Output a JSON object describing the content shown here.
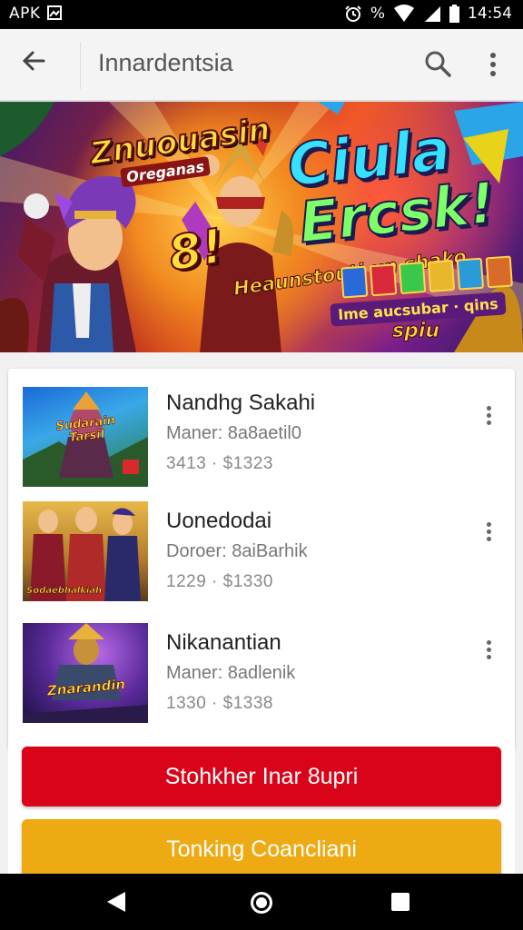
{
  "status_bar": {
    "left_text": "APK",
    "right_percent": "%",
    "time": "14:54",
    "icons": [
      "image-icon",
      "alarm-icon",
      "wifi-icon",
      "signal-icon",
      "battery-icon"
    ]
  },
  "app_bar": {
    "title": "Innardentsia",
    "icons": [
      "back-arrow-icon",
      "search-icon",
      "more-vert-icon"
    ]
  },
  "banner": {
    "logo_text": "Znuouasin",
    "logo_sub": "Oreganas",
    "title_line1": "Ciula",
    "title_line2": "Ercsk!",
    "number": "8!",
    "tag1": "Heaunstouti un shako",
    "tag2": "Ime aucsubar · qins",
    "tag3": "spiu"
  },
  "list": {
    "items": [
      {
        "name": "Nandhg Sakahi",
        "sub": "Maner: 8a8aetil0",
        "meta": "3413 · $1323",
        "thumb_caption": "Sudarain Tarsil"
      },
      {
        "name": "Uonedodai",
        "sub": "Doroer: 8aiBarhik",
        "meta": "1229 · $1330",
        "thumb_caption": "Sodaebhalkiah"
      },
      {
        "name": "Nikanantian",
        "sub": "Maner: 8adlenik",
        "meta": "1330 · $1338",
        "thumb_caption": "Znarandin"
      }
    ]
  },
  "buttons": {
    "primary": "Stohkher Inar 8upri",
    "secondary": "Tonking Coancliani"
  },
  "colors": {
    "primary_button": "#d9041a",
    "secondary_button": "#eeaa12",
    "status_bar": "#000000"
  }
}
